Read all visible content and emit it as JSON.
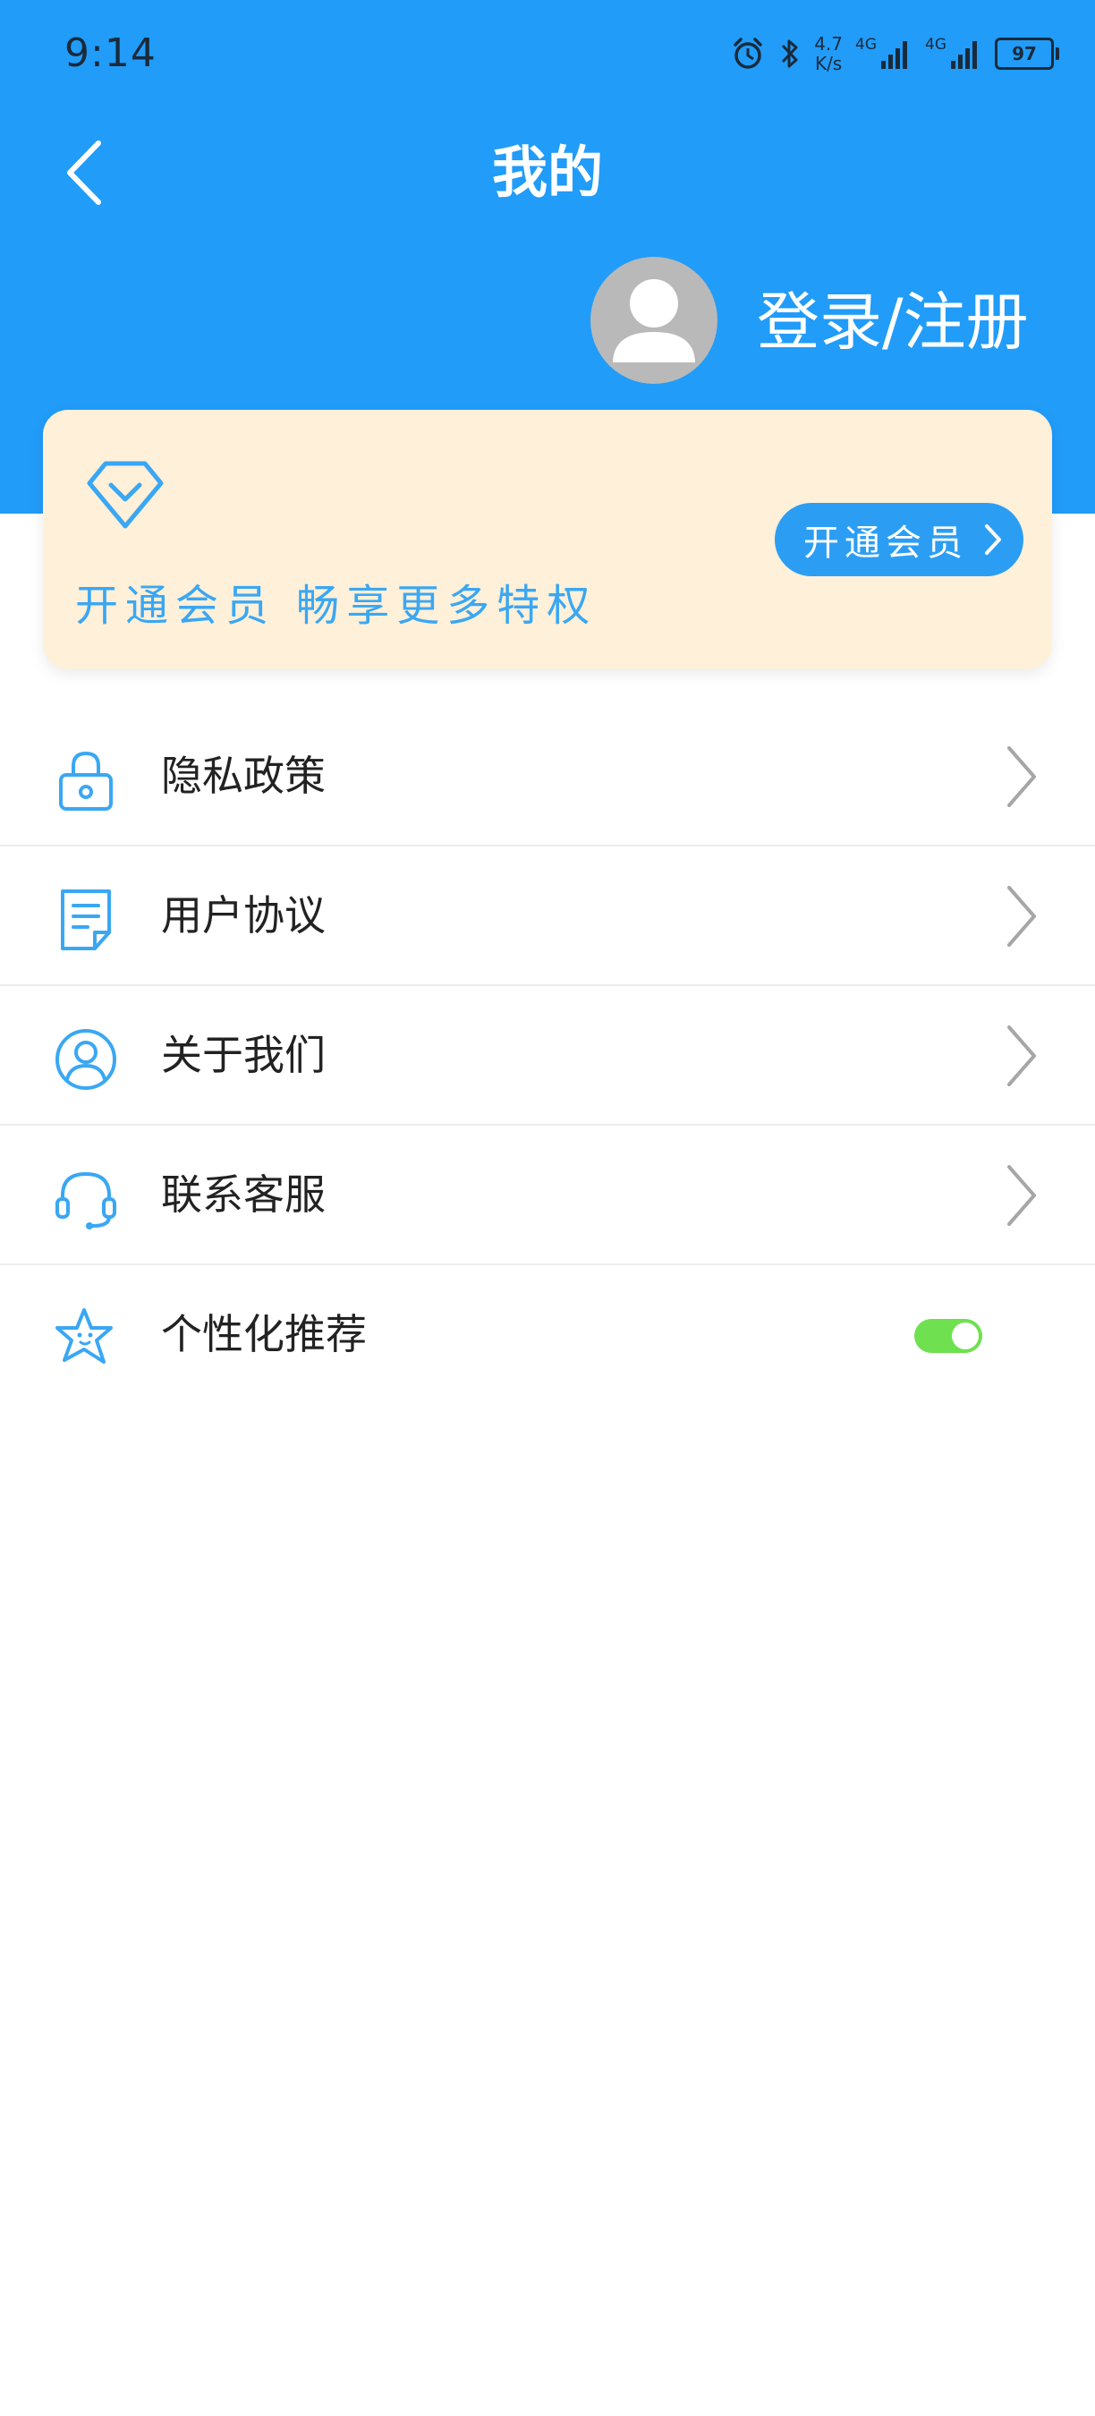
{
  "status_bar": {
    "time": "9:14",
    "net_speed_value": "4.7",
    "net_speed_unit": "K/s",
    "signal1_tag": "4G",
    "signal2_tag": "4G",
    "battery": "97"
  },
  "nav": {
    "title": "我的"
  },
  "profile": {
    "login_label": "登录/注册"
  },
  "member_card": {
    "tagline": "开通会员 畅享更多特权",
    "button_label": "开通会员"
  },
  "menu": {
    "items": [
      {
        "label": "隐私政策",
        "icon": "lock-icon"
      },
      {
        "label": "用户协议",
        "icon": "document-icon"
      },
      {
        "label": "关于我们",
        "icon": "user-circle-icon"
      },
      {
        "label": "联系客服",
        "icon": "headset-icon"
      },
      {
        "label": "个性化推荐",
        "icon": "star-icon",
        "toggle_on": true
      }
    ]
  },
  "colors": {
    "header_blue": "#219cf9",
    "accent_blue": "#2b9ef4",
    "card_bg": "#fff0d9",
    "toggle_on": "#6fe050"
  }
}
